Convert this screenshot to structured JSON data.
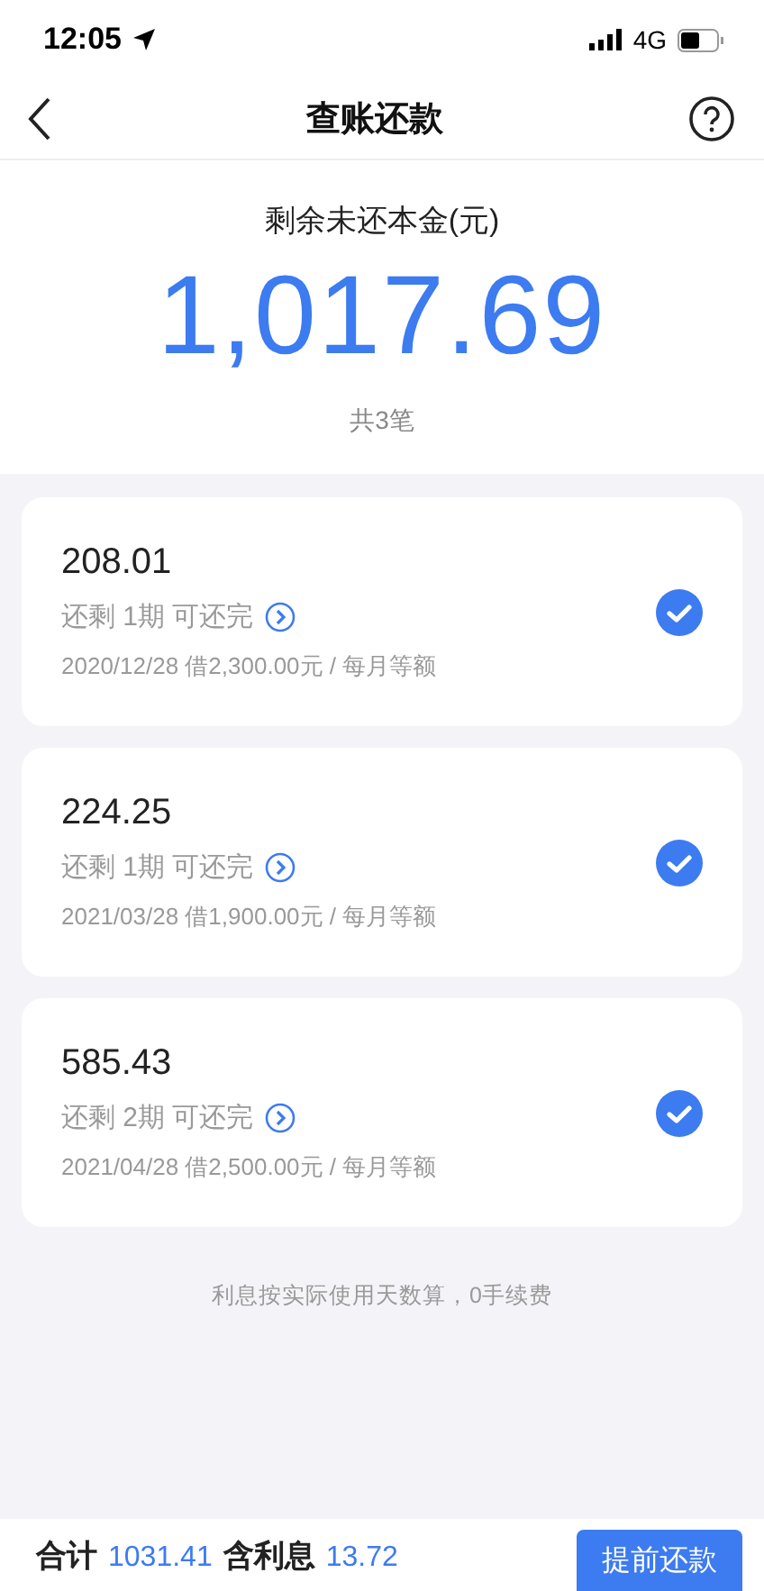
{
  "status_bar": {
    "time": "12:05",
    "network": "4G"
  },
  "nav": {
    "title": "查账还款"
  },
  "summary": {
    "label": "剩余未还本金(元)",
    "amount": "1,017.69",
    "count": "共3笔"
  },
  "loans": [
    {
      "amount": "208.01",
      "remaining": "还剩 1期 可还完",
      "detail": "2020/12/28 借2,300.00元 / 每月等额",
      "selected": true
    },
    {
      "amount": "224.25",
      "remaining": "还剩 1期 可还完",
      "detail": "2021/03/28 借1,900.00元 / 每月等额",
      "selected": true
    },
    {
      "amount": "585.43",
      "remaining": "还剩 2期 可还完",
      "detail": "2021/04/28 借2,500.00元 / 每月等额",
      "selected": true
    }
  ],
  "note": "利息按实际使用天数算，0手续费",
  "footer": {
    "total_label": "合计",
    "total": "1031.41",
    "interest_label": "含利息",
    "interest": "13.72",
    "button": "提前还款"
  }
}
